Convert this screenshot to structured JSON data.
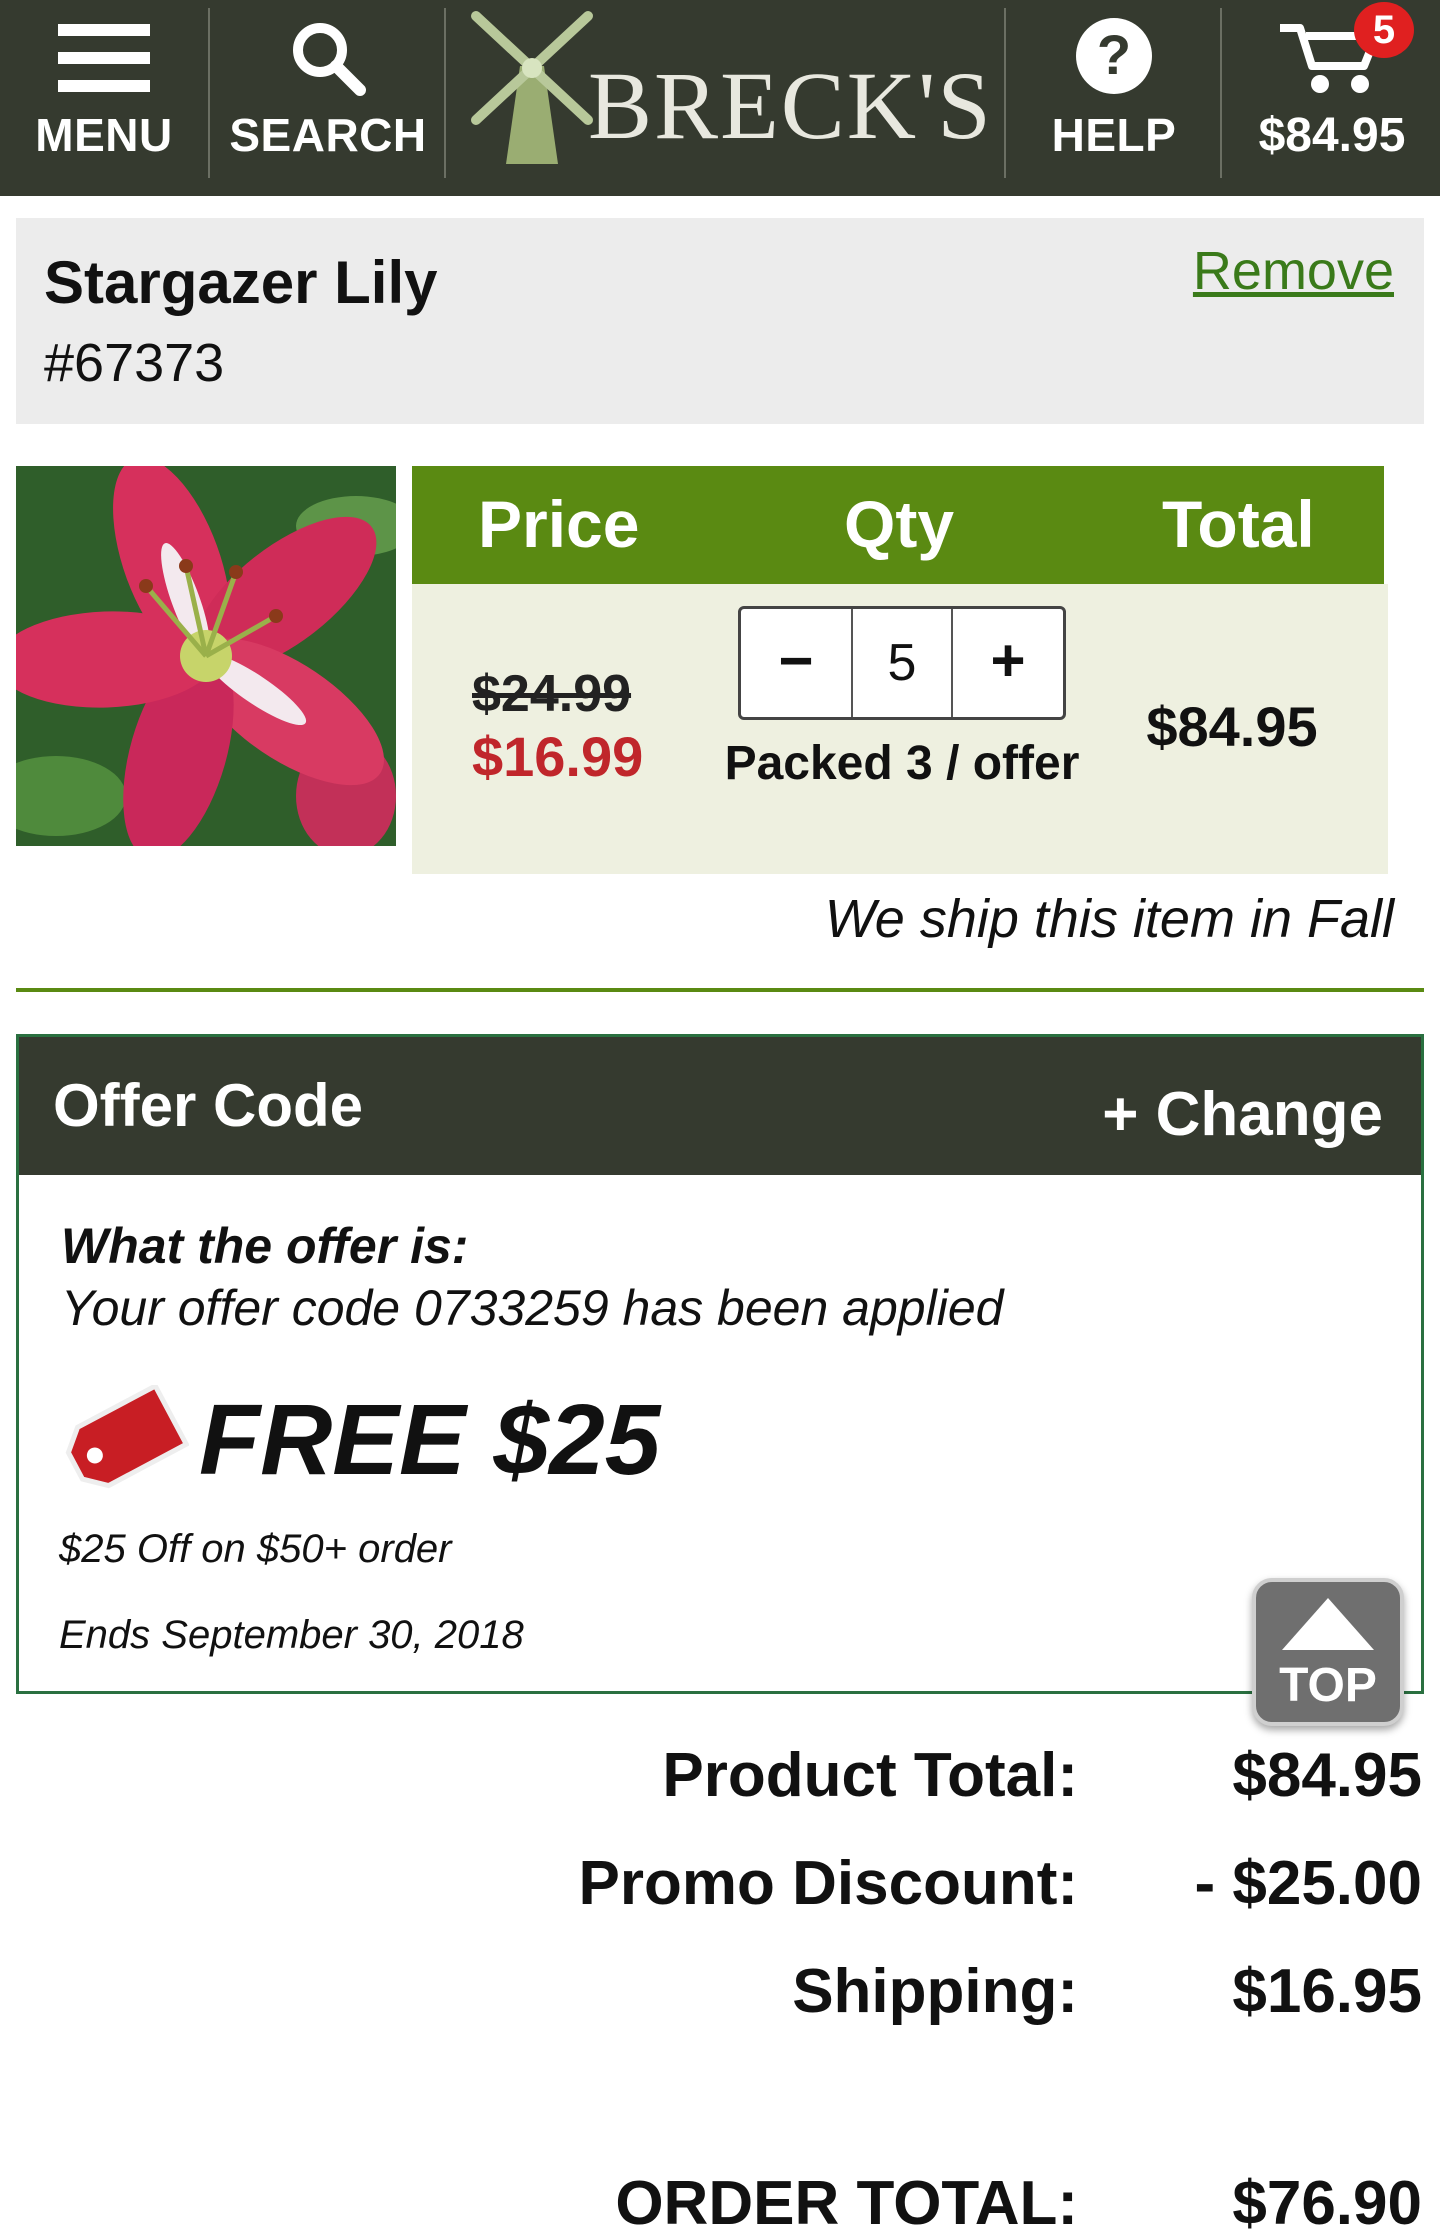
{
  "header": {
    "menu_label": "MENU",
    "search_label": "SEARCH",
    "brand": "BRECK'S",
    "help_label": "HELP",
    "cart_badge": "5",
    "cart_total": "$84.95"
  },
  "item": {
    "name": "Stargazer Lily",
    "number": "#67373",
    "remove_label": "Remove"
  },
  "table": {
    "headers": {
      "price": "Price",
      "qty": "Qty",
      "total": "Total"
    },
    "old_price": "$24.99",
    "sale_price": "$16.99",
    "qty_minus": "−",
    "qty_value": "5",
    "qty_plus": "+",
    "packed": "Packed 3 / offer",
    "row_total": "$84.95"
  },
  "ship_note": "We ship this item in Fall",
  "offer": {
    "title": "Offer Code",
    "change_label": "+ Change",
    "question": "What the offer is:",
    "applied": "Your offer code 0733259 has been applied",
    "amount": "FREE $25",
    "description": "$25 Off on $50+ order",
    "ends": "Ends September 30, 2018"
  },
  "top_button": "TOP",
  "summary": {
    "product_total_label": "Product Total:",
    "product_total_value": "$84.95",
    "promo_label": "Promo Discount:",
    "promo_value": "- $25.00",
    "shipping_label": "Shipping:",
    "shipping_value": "$16.95",
    "order_total_label": "ORDER TOTAL:",
    "order_total_value": "$76.90"
  },
  "colors": {
    "header_bg": "#353a2f",
    "accent_green": "#5a8a12",
    "sale_red": "#c0262b",
    "badge_red": "#e02020"
  }
}
